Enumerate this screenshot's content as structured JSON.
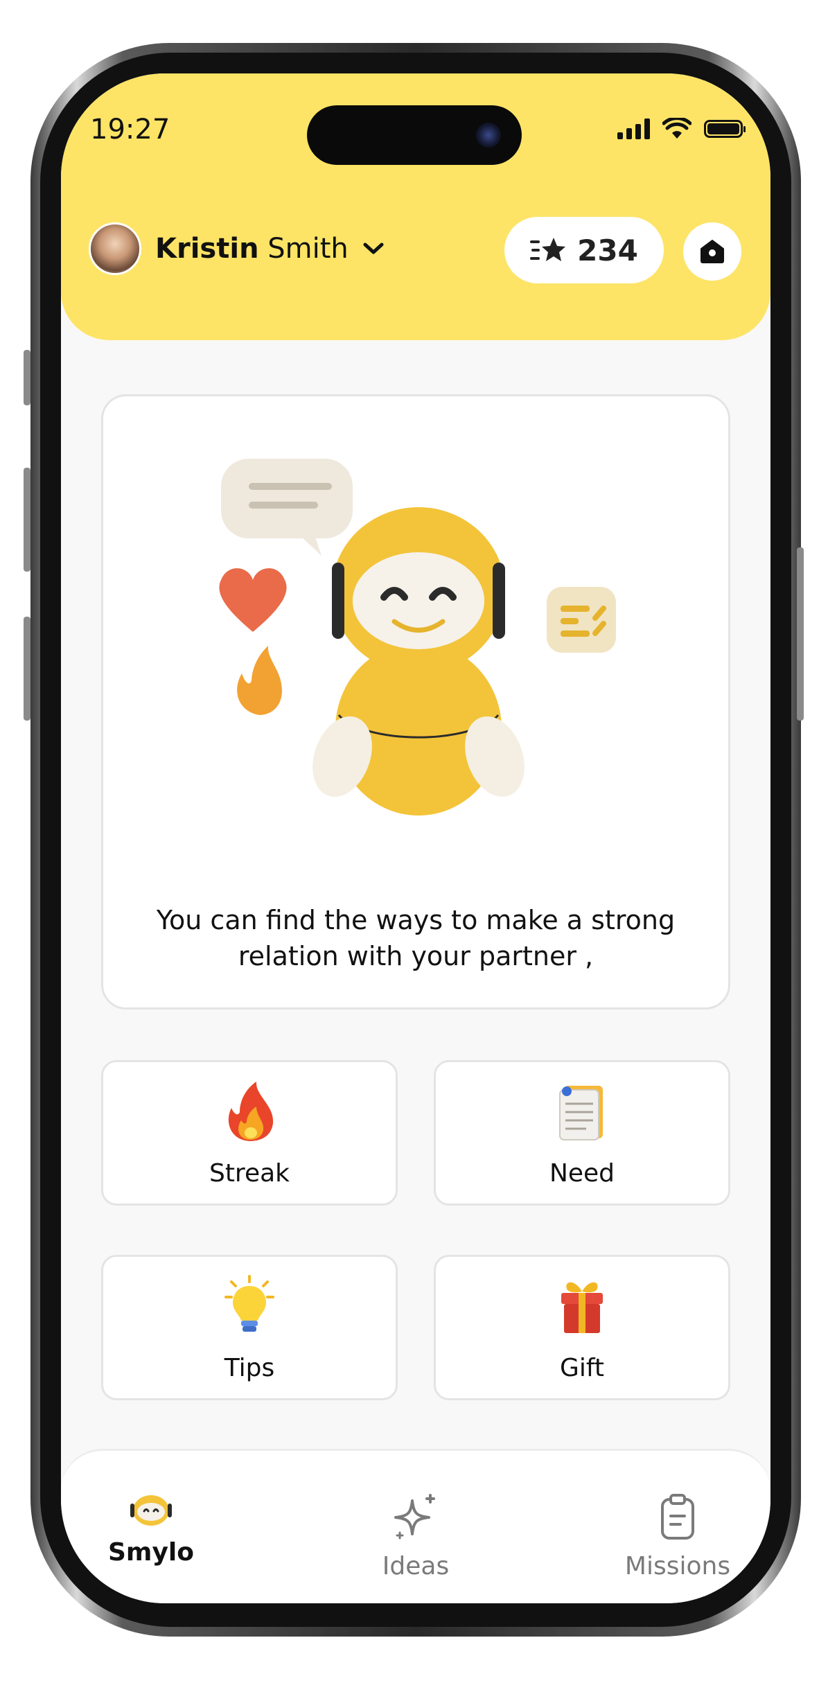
{
  "status_bar": {
    "time": "19:27"
  },
  "profile": {
    "first_name": "Kristin",
    "last_name": "Smith"
  },
  "points": {
    "value": "234"
  },
  "hero": {
    "message": "You can find the ways to make a strong relation with your partner ,"
  },
  "tiles": [
    {
      "label": "Streak",
      "icon": "fire-icon"
    },
    {
      "label": "Need",
      "icon": "notepad-icon"
    },
    {
      "label": "Tips",
      "icon": "lightbulb-icon"
    },
    {
      "label": "Gift",
      "icon": "gift-icon"
    }
  ],
  "nav": {
    "items": [
      {
        "label": "Smylo",
        "icon": "robot-face-icon",
        "active": true
      },
      {
        "label": "Ideas",
        "icon": "sparkles-icon",
        "active": false
      },
      {
        "label": "Missions",
        "icon": "clipboard-icon",
        "active": false
      }
    ]
  },
  "colors": {
    "header": "#fde466",
    "accent": "#f5c518",
    "active_nav": "#111111",
    "inactive_nav": "#7a7a7a"
  }
}
